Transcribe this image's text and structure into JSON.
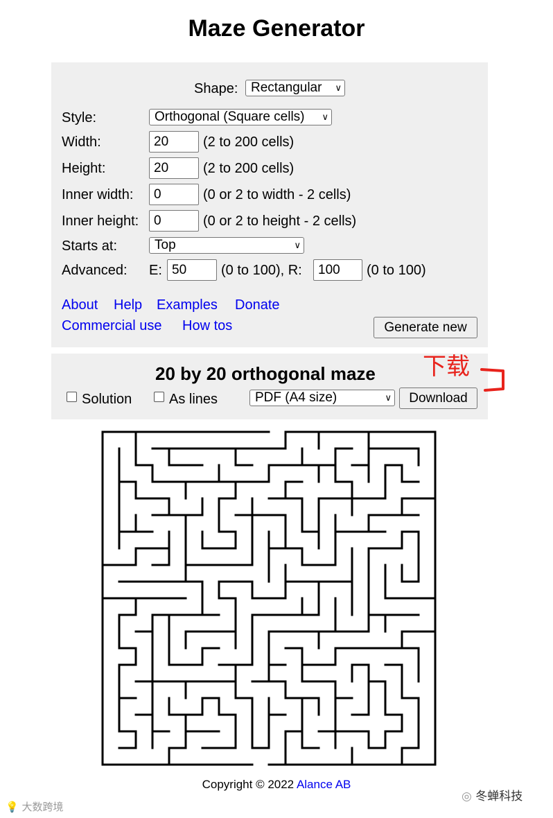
{
  "title": "Maze Generator",
  "form": {
    "shape_label": "Shape:",
    "shape_value": "Rectangular",
    "style_label": "Style:",
    "style_value": "Orthogonal (Square cells)",
    "width_label": "Width:",
    "width_value": "20",
    "width_hint": "(2 to 200 cells)",
    "height_label": "Height:",
    "height_value": "20",
    "height_hint": "(2 to 200 cells)",
    "inner_width_label": "Inner width:",
    "inner_width_value": "0",
    "inner_width_hint": "(0 or 2 to width - 2 cells)",
    "inner_height_label": "Inner height:",
    "inner_height_value": "0",
    "inner_height_hint": "(0 or 2 to height - 2 cells)",
    "starts_label": "Starts at:",
    "starts_value": "Top",
    "advanced_label": "Advanced:",
    "e_label": "E:",
    "e_value": "50",
    "e_hint": "(0 to 100), R:",
    "r_value": "100",
    "r_hint": "(0 to 100)"
  },
  "links": {
    "about": "About",
    "help": "Help",
    "examples": "Examples",
    "donate": "Donate",
    "commercial": "Commercial use",
    "howtos": "How tos"
  },
  "generate_button": "Generate new",
  "result": {
    "heading": "20 by 20 orthogonal maze",
    "solution_label": "Solution",
    "solution_checked": false,
    "as_lines_label": "As lines",
    "as_lines_checked": false,
    "format_value": "PDF (A4 size)",
    "download_button": "Download"
  },
  "annotation": {
    "text": "下载",
    "color": "#e8231c"
  },
  "maze": {
    "rows": 20,
    "cols": 20
  },
  "footer": {
    "copyright": "Copyright © 2022",
    "company": "Alance AB"
  },
  "watermarks": {
    "left": "大数跨境",
    "right": "冬蝉科技"
  }
}
